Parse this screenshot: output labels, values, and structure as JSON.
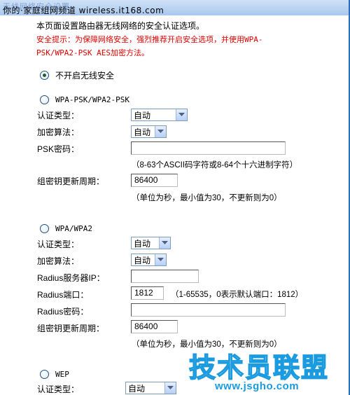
{
  "window": {
    "title": "无线网络安全设置",
    "source_watermark": "你的·家庭组网频道 wireless.it168.com"
  },
  "intro": {
    "line1": "本页面设置路由器无线网络的安全认证选项。",
    "warning_line1": "安全提示：为保障网络安全，强烈推荐开启安全选项，并使用WPA-",
    "warning_line2": "PSK/WPA2-PSK AES加密方法。"
  },
  "options": {
    "none": {
      "label": "不开启无线安全",
      "checked": true
    },
    "wpa_psk": {
      "label": "WPA-PSK/WPA2-PSK",
      "checked": false,
      "auth_type_label": "认证类型：",
      "auth_type_value": "自动",
      "encryption_label": "加密算法：",
      "encryption_value": "自动",
      "psk_label": "PSK密码：",
      "psk_value": "",
      "psk_hint": "（8-63个ASCII码字符或8-64个十六进制字符）",
      "group_key_label": "组密钥更新周期：",
      "group_key_value": "86400",
      "group_key_hint": "（单位为秒，最小值为30，不更新则为0）"
    },
    "wpa": {
      "label": "WPA/WPA2",
      "checked": false,
      "auth_type_label": "认证类型：",
      "auth_type_value": "自动",
      "encryption_label": "加密算法：",
      "encryption_value": "自动",
      "radius_ip_label": "Radius服务器IP：",
      "radius_ip_value": "",
      "radius_port_label": "Radius端口：",
      "radius_port_value": "1812",
      "radius_port_hint": "（1-65535，0表示默认端口：1812）",
      "radius_pwd_label": "Radius密码：",
      "radius_pwd_value": "",
      "group_key_label": "组密钥更新周期：",
      "group_key_value": "86400",
      "group_key_hint": "（单位为秒，最小值为30，不更新则为0）"
    },
    "wep": {
      "label": "WEP",
      "checked": false,
      "auth_type_label": "认证类型：",
      "auth_type_value": "自动"
    }
  },
  "site_watermark": {
    "logo_text": "技术员联盟",
    "url": "www.jsgho.com"
  }
}
